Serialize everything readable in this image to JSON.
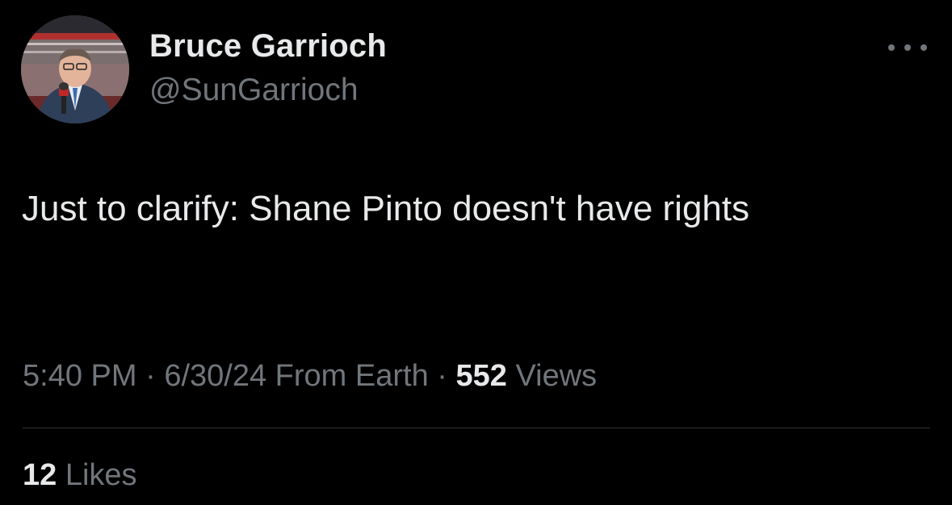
{
  "tweet": {
    "author": {
      "display_name": "Bruce Garrioch",
      "handle": "@SunGarrioch",
      "avatar_icon": "profile-photo"
    },
    "more_icon": "more-horizontal-icon",
    "text": "Just to clarify: Shane Pinto doesn't have rights",
    "meta": {
      "time": "5:40 PM",
      "separator": "·",
      "date": "6/30/24",
      "source": "From Earth",
      "views_count": "552",
      "views_label": "Views"
    },
    "engagement": {
      "likes_count": "12",
      "likes_label": "Likes"
    }
  },
  "colors": {
    "background": "#000000",
    "primary_text": "#e7e9ea",
    "secondary_text": "#71767b",
    "divider": "#2f3336"
  }
}
